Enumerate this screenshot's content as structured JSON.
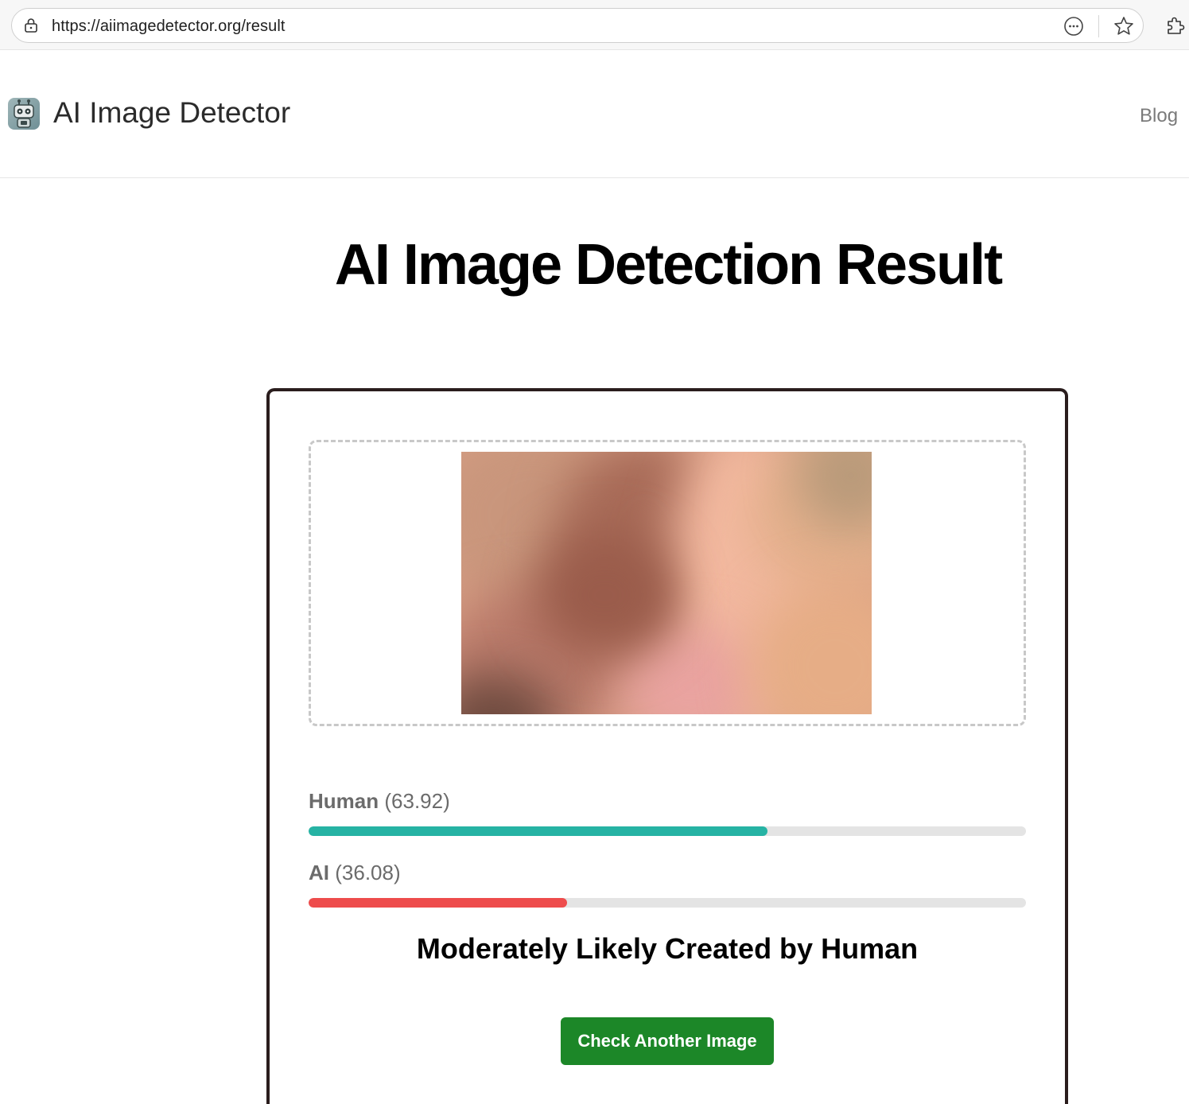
{
  "browser": {
    "url": "https://aiimagedetector.org/result"
  },
  "header": {
    "site_title": "AI Image Detector",
    "nav": {
      "blog_label": "Blog"
    }
  },
  "main": {
    "title": "AI Image Detection Result",
    "scores": {
      "human": {
        "name": "Human",
        "value_text": "(63.92)",
        "value": 63.92,
        "color": "#26b3a4"
      },
      "ai": {
        "name": "AI",
        "value_text": "(36.08)",
        "value": 36.08,
        "color": "#ee4c4c"
      }
    },
    "verdict": "Moderately Likely Created by Human",
    "check_button_label": "Check Another Image"
  },
  "icons": {
    "lock": "lock-icon",
    "more": "more-options-icon",
    "favorite": "star-icon",
    "extensions": "puzzle-icon",
    "logo": "robot-logo-icon"
  },
  "colors": {
    "button": "#1c8728",
    "card_border": "#2a1d1d"
  }
}
